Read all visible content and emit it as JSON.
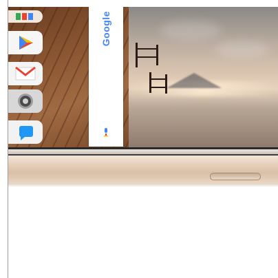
{
  "widget": {
    "brand": "Google"
  },
  "icons": {
    "dock": [
      "photos-icon",
      "play-store-icon",
      "gmail-icon",
      "settings-icon",
      "messages-icon"
    ],
    "search": "microphone-icon"
  },
  "colors": {
    "google_blue": "#4285f4",
    "google_red": "#ea4335",
    "google_yellow": "#fbbc05",
    "google_green": "#34a853",
    "phone_gold": "#e2c9b1"
  }
}
